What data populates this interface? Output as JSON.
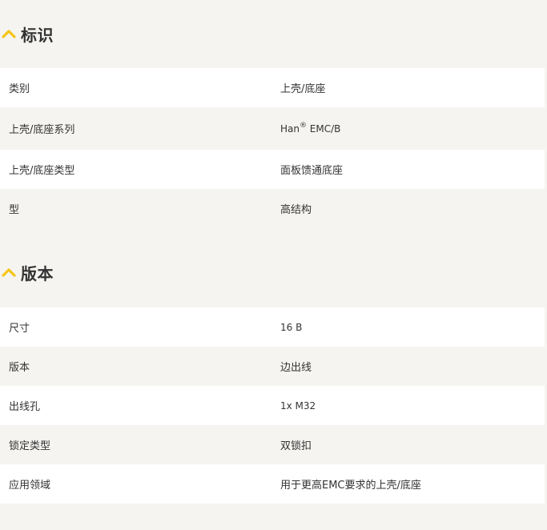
{
  "colors": {
    "accent": "#f5c518",
    "row_white": "#ffffff",
    "row_grey": "#f5f4f1",
    "page_bg": "#f5f4f1",
    "text": "#333333"
  },
  "sections": [
    {
      "icon": "chevron-up-icon",
      "title": "标识",
      "rows": [
        {
          "label": "类别",
          "value": "上壳/底座"
        },
        {
          "label": "上壳/底座系列",
          "value_main": "Han",
          "value_sup": "®",
          "value_rest": " EMC/B"
        },
        {
          "label": "上壳/底座类型",
          "value": "面板馈通底座"
        },
        {
          "label": "型",
          "value": "高结构"
        }
      ]
    },
    {
      "icon": "chevron-up-icon",
      "title": "版本",
      "rows": [
        {
          "label": "尺寸",
          "value": "16 B"
        },
        {
          "label": "版本",
          "value": "边出线"
        },
        {
          "label": "出线孔",
          "value": "1x M32"
        },
        {
          "label": "锁定类型",
          "value": "双锁扣"
        },
        {
          "label": "应用领域",
          "value": "用于更高EMC要求的上壳/底座"
        }
      ]
    }
  ]
}
